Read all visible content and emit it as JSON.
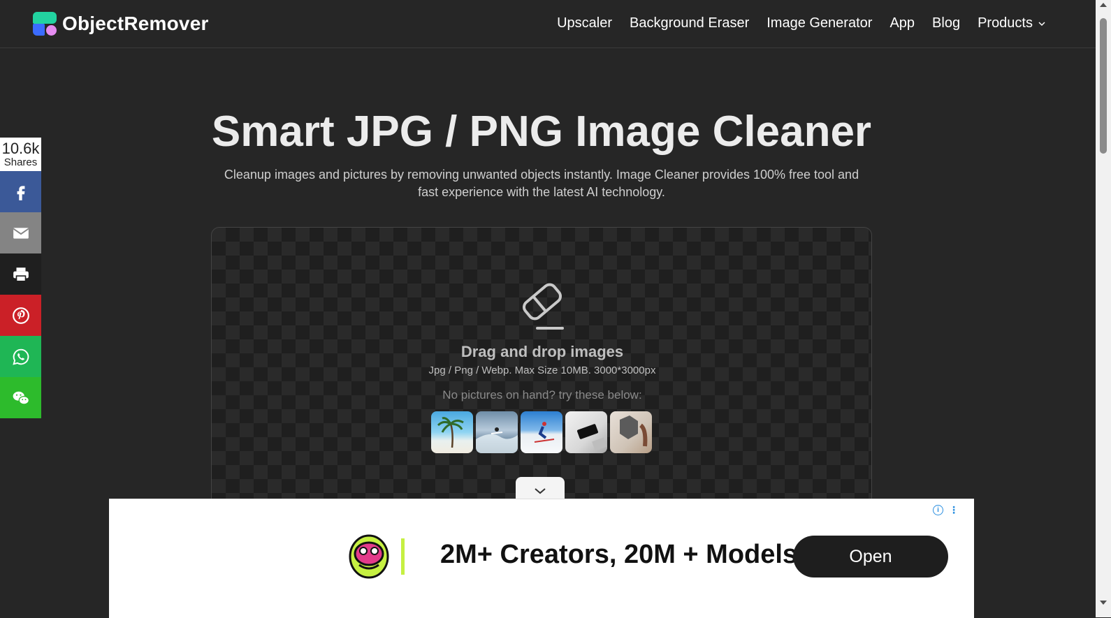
{
  "header": {
    "logo_text": "ObjectRemover",
    "nav": [
      {
        "label": "Upscaler"
      },
      {
        "label": "Background Eraser"
      },
      {
        "label": "Image Generator"
      },
      {
        "label": "App"
      },
      {
        "label": "Blog"
      },
      {
        "label": "Products"
      }
    ]
  },
  "share": {
    "count": "10.6k",
    "count_label": "Shares",
    "buttons": [
      {
        "icon": "facebook-icon",
        "color": "#3b5998"
      },
      {
        "icon": "email-icon",
        "color": "#848484"
      },
      {
        "icon": "print-icon",
        "color": "#1f1f1f"
      },
      {
        "icon": "pinterest-icon",
        "color": "#cb2027"
      },
      {
        "icon": "whatsapp-icon",
        "color": "#1fb655"
      },
      {
        "icon": "wechat-icon",
        "color": "#2dbb2c"
      }
    ]
  },
  "hero": {
    "title": "Smart JPG / PNG Image Cleaner",
    "subtitle": "Cleanup images and pictures by removing unwanted objects instantly. Image Cleaner provides 100% free tool and fast experience with the latest AI technology."
  },
  "upload": {
    "icon": "eraser-icon",
    "title": "Drag and drop images",
    "formats": "Jpg / Png / Webp. Max Size 10MB. 3000*3000px",
    "try_text": "No pictures on hand? try these below:"
  },
  "ad": {
    "headline": "2M+ Creators, 20M + Models",
    "button": "Open"
  },
  "colors": {
    "background": "#262626",
    "accent_green": "#22d3a0",
    "accent_blue": "#3b6cff",
    "accent_pink": "#e58cf0"
  }
}
